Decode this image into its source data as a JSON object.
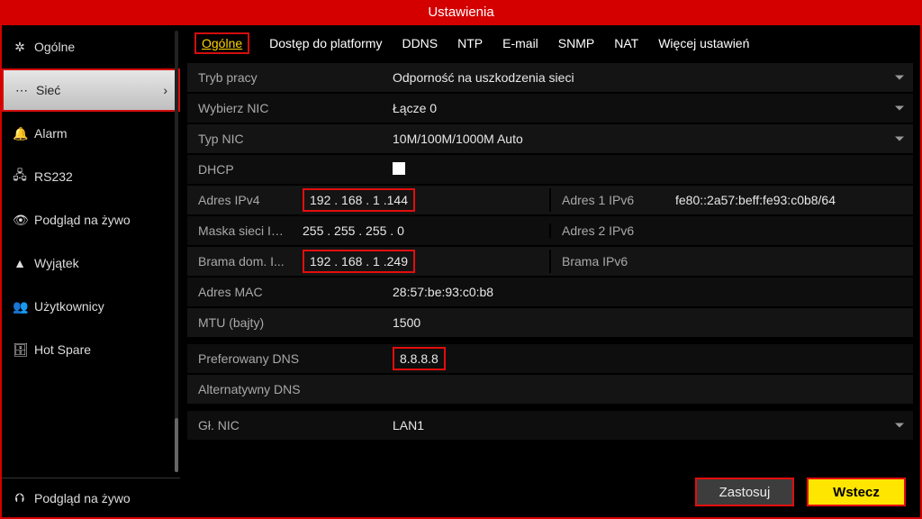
{
  "title": "Ustawienia",
  "sidebar": {
    "items": [
      {
        "icon": "✲",
        "label": "Ogólne"
      },
      {
        "icon": "⋯",
        "label": "Sieć",
        "active": true
      },
      {
        "icon": "🔔",
        "label": "Alarm"
      },
      {
        "icon": "🖧",
        "label": "RS232"
      },
      {
        "icon": "👁",
        "label": "Podgląd na żywo"
      },
      {
        "icon": "▲",
        "label": "Wyjątek"
      },
      {
        "icon": "👥",
        "label": "Użytkownicy"
      },
      {
        "icon": "🗄",
        "label": "Hot Spare"
      }
    ],
    "bottom": {
      "icon": "⮉",
      "label": "Podgląd na żywo"
    }
  },
  "tabs": [
    {
      "label": "Ogólne",
      "active": true
    },
    {
      "label": "Dostęp do platformy"
    },
    {
      "label": "DDNS"
    },
    {
      "label": "NTP"
    },
    {
      "label": "E-mail"
    },
    {
      "label": "SNMP"
    },
    {
      "label": "NAT"
    },
    {
      "label": "Więcej ustawień"
    }
  ],
  "fields": {
    "work_mode": {
      "label": "Tryb pracy",
      "value": "Odporność na uszkodzenia sieci"
    },
    "select_nic": {
      "label": "Wybierz NIC",
      "value": "Łącze 0"
    },
    "nic_type": {
      "label": "Typ NIC",
      "value": "10M/100M/1000M Auto"
    },
    "dhcp": {
      "label": "DHCP"
    },
    "ipv4": {
      "label": "Adres IPv4",
      "value": "192 . 168 . 1     .144"
    },
    "ipv6_1": {
      "label": "Adres 1 IPv6",
      "value": "fe80::2a57:beff:fe93:c0b8/64"
    },
    "mask": {
      "label": "Maska sieci IP...",
      "value": "255 . 255 . 255 . 0"
    },
    "ipv6_2": {
      "label": "Adres 2 IPv6",
      "value": ""
    },
    "gw": {
      "label": "Brama dom. I...",
      "value": "192 . 168 . 1     .249"
    },
    "ipv6_gw": {
      "label": "Brama IPv6",
      "value": ""
    },
    "mac": {
      "label": "Adres MAC",
      "value": "28:57:be:93:c0:b8"
    },
    "mtu": {
      "label": "MTU (bajty)",
      "value": "1500"
    },
    "dns1": {
      "label": "Preferowany DNS",
      "value": "8.8.8.8"
    },
    "dns2": {
      "label": "Alternatywny DNS",
      "value": ""
    },
    "main_nic": {
      "label": "Gł. NIC",
      "value": "LAN1"
    }
  },
  "buttons": {
    "apply": "Zastosuj",
    "back": "Wstecz"
  }
}
